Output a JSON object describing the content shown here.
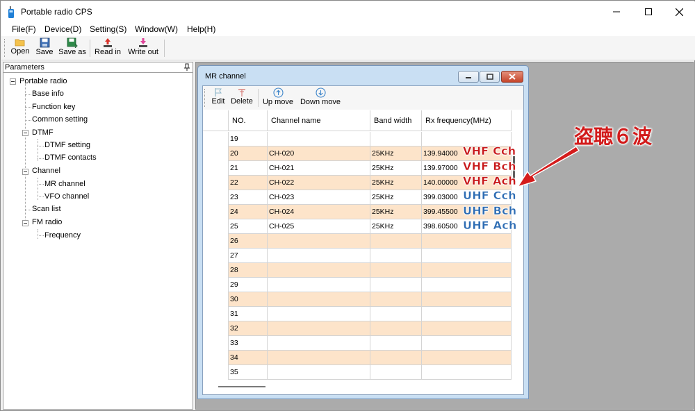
{
  "window": {
    "title": "Portable radio CPS"
  },
  "menu": [
    "File(F)",
    "Device(D)",
    "Setting(S)",
    "Window(W)",
    "Help(H)"
  ],
  "toolbar": [
    {
      "label": "Open",
      "icon": "folder-icon"
    },
    {
      "label": "Save",
      "icon": "floppy-icon"
    },
    {
      "label": "Save as",
      "icon": "floppy-green-icon"
    },
    {
      "label": "Read in",
      "icon": "upload-red-icon"
    },
    {
      "label": "Write out",
      "icon": "download-pink-icon"
    }
  ],
  "panel": {
    "title": "Parameters",
    "tree": [
      {
        "label": "Portable radio"
      },
      {
        "label": "Base info"
      },
      {
        "label": "Function key"
      },
      {
        "label": "Common setting"
      },
      {
        "label": "DTMF"
      },
      {
        "label": "DTMF setting"
      },
      {
        "label": "DTMF contacts"
      },
      {
        "label": "Channel"
      },
      {
        "label": "MR channel"
      },
      {
        "label": "VFO channel"
      },
      {
        "label": "Scan list"
      },
      {
        "label": "FM radio"
      },
      {
        "label": "Frequency"
      }
    ]
  },
  "mr_window": {
    "title": "MR channel",
    "toolbar": [
      {
        "label": "Edit",
        "icon": "edit-flag-icon"
      },
      {
        "label": "Delete",
        "icon": "delete-icon"
      },
      {
        "label": "Up move",
        "icon": "up-arrow-circle-icon"
      },
      {
        "label": "Down move",
        "icon": "down-arrow-circle-icon"
      }
    ],
    "columns": [
      "NO.",
      "Channel name",
      "Band width",
      "Rx frequency(MHz)"
    ],
    "rows": [
      {
        "no": "19",
        "name": "",
        "bw": "",
        "rx": ""
      },
      {
        "no": "20",
        "name": "CH-020",
        "bw": "25KHz",
        "rx": "139.94000"
      },
      {
        "no": "21",
        "name": "CH-021",
        "bw": "25KHz",
        "rx": "139.97000"
      },
      {
        "no": "22",
        "name": "CH-022",
        "bw": "25KHz",
        "rx": "140.00000"
      },
      {
        "no": "23",
        "name": "CH-023",
        "bw": "25KHz",
        "rx": "399.03000"
      },
      {
        "no": "24",
        "name": "CH-024",
        "bw": "25KHz",
        "rx": "399.45500"
      },
      {
        "no": "25",
        "name": "CH-025",
        "bw": "25KHz",
        "rx": "398.60500"
      },
      {
        "no": "26",
        "name": "",
        "bw": "",
        "rx": ""
      },
      {
        "no": "27",
        "name": "",
        "bw": "",
        "rx": ""
      },
      {
        "no": "28",
        "name": "",
        "bw": "",
        "rx": ""
      },
      {
        "no": "29",
        "name": "",
        "bw": "",
        "rx": ""
      },
      {
        "no": "30",
        "name": "",
        "bw": "",
        "rx": ""
      },
      {
        "no": "31",
        "name": "",
        "bw": "",
        "rx": ""
      },
      {
        "no": "32",
        "name": "",
        "bw": "",
        "rx": ""
      },
      {
        "no": "33",
        "name": "",
        "bw": "",
        "rx": ""
      },
      {
        "no": "34",
        "name": "",
        "bw": "",
        "rx": ""
      },
      {
        "no": "35",
        "name": "",
        "bw": "",
        "rx": ""
      }
    ]
  },
  "overlay": {
    "labels": [
      "VHF Cch",
      "VHF Bch",
      "VHF Ach",
      "UHF Cch",
      "UHF Bch",
      "UHF Ach"
    ],
    "annotation": "盗聴６波",
    "colors": {
      "vhf": "#c8181a",
      "uhf": "#2e6db4",
      "annotation": "#d21a1a",
      "row_even": "#fde4ca"
    }
  }
}
